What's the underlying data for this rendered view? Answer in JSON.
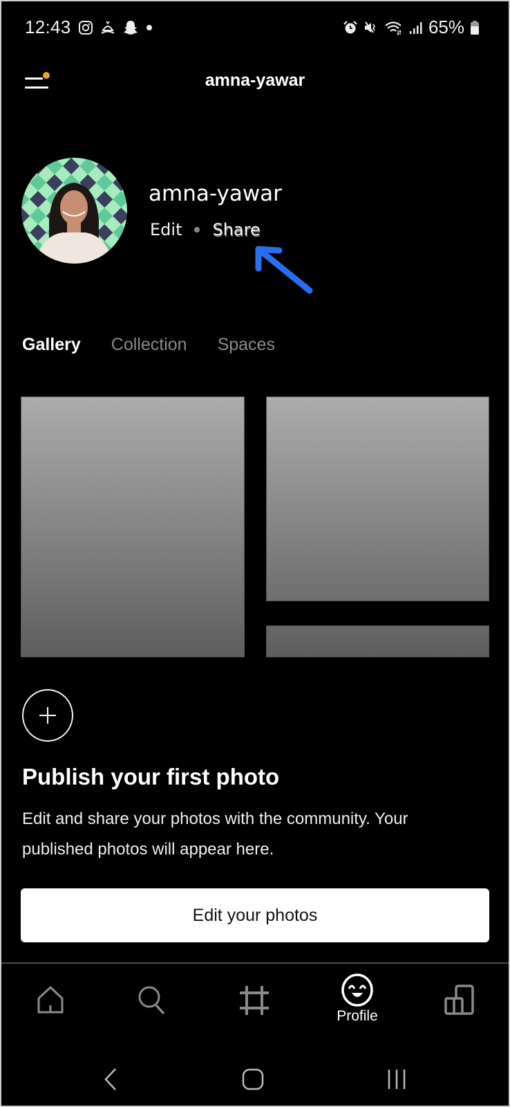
{
  "status_bar": {
    "time": "12:43",
    "left_icons": [
      "instagram-icon",
      "prayer-app-icon",
      "snapchat-icon",
      "notification-dot-icon"
    ],
    "right_icons": [
      "alarm-icon",
      "vibrate-mute-icon",
      "wifi-icon",
      "signal-icon",
      "battery-icon"
    ],
    "battery_percent": "65%"
  },
  "header": {
    "title": "amna-yawar",
    "menu_badge_color": "#e9a82a"
  },
  "profile": {
    "username": "amna-yawar",
    "edit_label": "Edit",
    "share_label": "Share",
    "annotation": "arrow pointing to Share",
    "annotation_color": "#2a6ef0"
  },
  "tabs": [
    {
      "label": "Gallery",
      "active": true
    },
    {
      "label": "Collection",
      "active": false
    },
    {
      "label": "Spaces",
      "active": false
    }
  ],
  "empty_state": {
    "title": "Publish your first photo",
    "description": "Edit and share your photos with the community. Your published photos will appear here.",
    "button_label": "Edit your photos"
  },
  "bottom_nav": [
    {
      "name": "home",
      "label": "",
      "active": false
    },
    {
      "name": "search",
      "label": "",
      "active": false
    },
    {
      "name": "crop",
      "label": "",
      "active": false
    },
    {
      "name": "profile",
      "label": "Profile",
      "active": true
    },
    {
      "name": "manage",
      "label": "",
      "active": false
    }
  ],
  "system_nav": [
    "back",
    "home",
    "recents"
  ]
}
